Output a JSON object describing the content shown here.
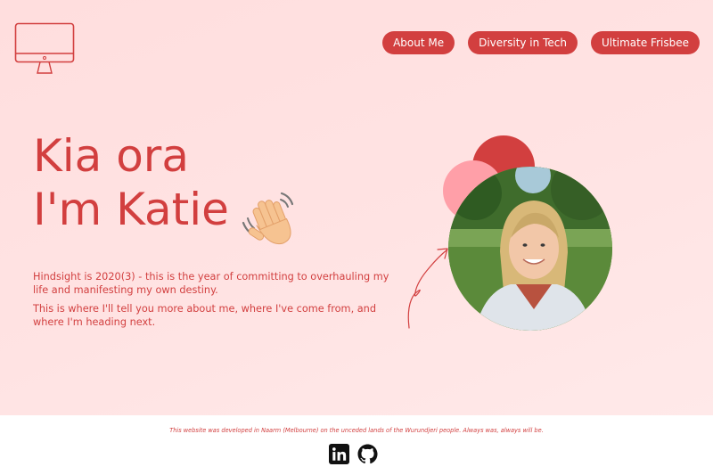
{
  "nav": {
    "items": [
      {
        "label": "About Me"
      },
      {
        "label": "Diversity in Tech"
      },
      {
        "label": "Ultimate Frisbee"
      }
    ]
  },
  "hero": {
    "greeting": "Kia ora",
    "name_line": "I'm Katie",
    "paragraphs": [
      "Hindsight is 2020(3) - this is the year of committing to overhauling my life and manifesting my own destiny.",
      "This is where I'll tell you more about me, where I've come from, and where I'm heading next."
    ]
  },
  "footer": {
    "note": "This website was developed in Naarm (Melbourne) on the unceded lands of the Wurundjeri people. Always was, always will be."
  },
  "icons": {
    "logo": "computer-monitor-icon",
    "wave": "waving-hand-icon",
    "social": [
      "linkedin-icon",
      "github-icon"
    ]
  },
  "colors": {
    "accent": "#d23f3f",
    "accent_light": "#ff9fa8",
    "background": "#ffe1e1",
    "footer_bg": "#ffffff"
  }
}
